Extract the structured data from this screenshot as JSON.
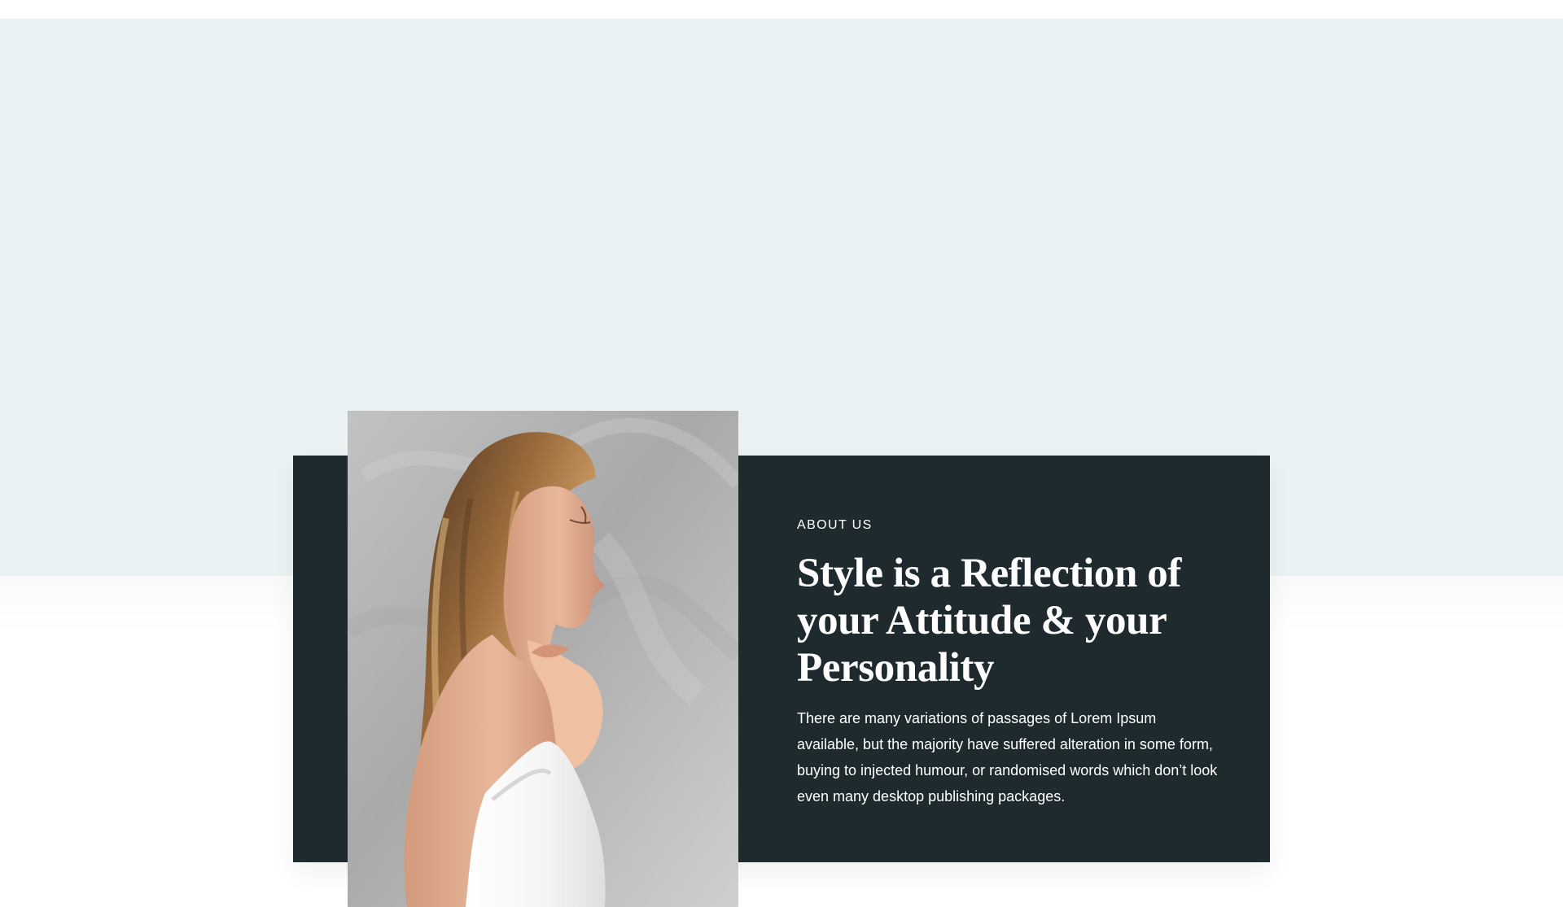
{
  "about": {
    "eyebrow": "ABOUT US",
    "title": "Style is a Reflection of your Attitude & your Personality",
    "body": "There are many variations of passages of Lorem Ipsum available, but the majority have suffered alteration in some form, buying to injected humour, or randomised words which don’t look even many desktop publishing packages."
  },
  "colors": {
    "hero_background": "#eaf2f3",
    "card_background": "#1f2a2f",
    "text": "#ffffff"
  },
  "image": {
    "subject": "woman-profile-with-towel"
  }
}
